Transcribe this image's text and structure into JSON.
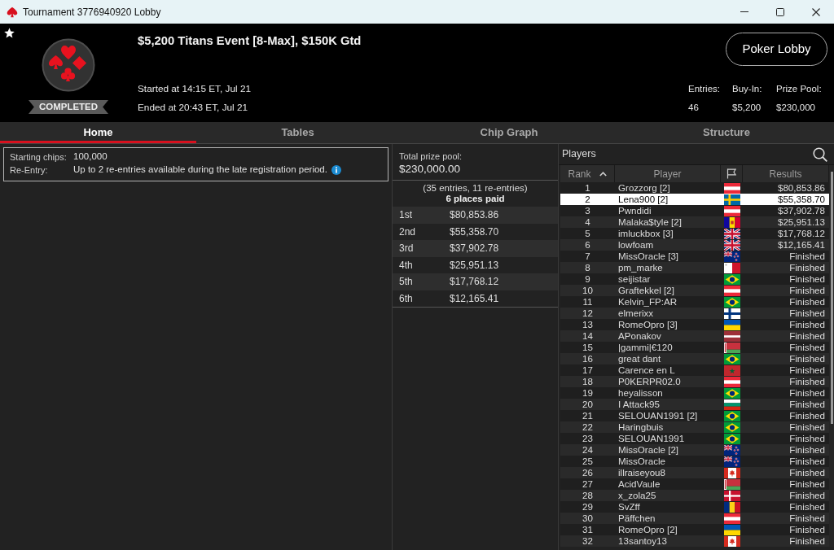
{
  "window": {
    "title": "Tournament 3776940920 Lobby"
  },
  "header": {
    "status": "COMPLETED",
    "title": "$5,200 Titans Event [8-Max], $150K Gtd",
    "started": "Started at 14:15 ET, Jul 21",
    "ended": "Ended at 20:43 ET, Jul 21",
    "button": "Poker Lobby",
    "stats": [
      {
        "label": "Entries:",
        "value": "46"
      },
      {
        "label": "Buy-In:",
        "value": "$5,200"
      },
      {
        "label": "Prize Pool:",
        "value": "$230,000"
      }
    ]
  },
  "tabs": [
    {
      "label": "Home",
      "selected": true
    },
    {
      "label": "Tables",
      "selected": false
    },
    {
      "label": "Chip Graph",
      "selected": false
    },
    {
      "label": "Structure",
      "selected": false
    }
  ],
  "info": [
    {
      "label": "Starting chips:",
      "value": "100,000",
      "info_icon": false
    },
    {
      "label": "Re-Entry:",
      "value": "Up to 2 re-entries available during the late registration period.",
      "info_icon": true
    }
  ],
  "prize_pool": {
    "label": "Total prize pool:",
    "total": "$230,000.00",
    "entries_note": "(35 entries, 11 re-entries)",
    "places_paid": "6 places paid",
    "payouts": [
      {
        "place": "1st",
        "amount": "$80,853.86"
      },
      {
        "place": "2nd",
        "amount": "$55,358.70"
      },
      {
        "place": "3rd",
        "amount": "$37,902.78"
      },
      {
        "place": "4th",
        "amount": "$25,951.13"
      },
      {
        "place": "5th",
        "amount": "$17,768.12"
      },
      {
        "place": "6th",
        "amount": "$12,165.41"
      }
    ]
  },
  "players": {
    "title": "Players",
    "columns": [
      {
        "kind": "text",
        "label": "Rank",
        "sorted": true
      },
      {
        "kind": "text",
        "label": "Player",
        "sorted": false
      },
      {
        "kind": "flag",
        "sorted": false
      },
      {
        "kind": "text",
        "label": "Results",
        "sorted": false
      }
    ],
    "rows": [
      {
        "rank": "1",
        "player": "Grozzorg [2]",
        "flag": {
          "kind": "at"
        },
        "result": "$80,853.86",
        "selected": false
      },
      {
        "rank": "2",
        "player": "Lena900 [2]",
        "flag": {
          "kind": "se"
        },
        "result": "$55,358.70",
        "selected": true
      },
      {
        "rank": "3",
        "player": "Pwndidi",
        "flag": {
          "kind": "at"
        },
        "result": "$37,902.78",
        "selected": false
      },
      {
        "rank": "4",
        "player": "Malaka$tyle [2]",
        "flag": {
          "kind": "ad"
        },
        "result": "$25,951.13",
        "selected": false
      },
      {
        "rank": "5",
        "player": "imluckbox [3]",
        "flag": {
          "kind": "gb"
        },
        "result": "$17,768.12",
        "selected": false
      },
      {
        "rank": "6",
        "player": "lowfoam",
        "flag": {
          "kind": "gb"
        },
        "result": "$12,165.41",
        "selected": false
      },
      {
        "rank": "7",
        "player": "MissOracle [3]",
        "flag": {
          "kind": "nz"
        },
        "result": "Finished",
        "selected": false
      },
      {
        "rank": "8",
        "player": "pm_marke",
        "flag": {
          "kind": "mt"
        },
        "result": "Finished",
        "selected": false
      },
      {
        "rank": "9",
        "player": "seijistar",
        "flag": {
          "kind": "br"
        },
        "result": "Finished",
        "selected": false
      },
      {
        "rank": "10",
        "player": "Graftekkel [2]",
        "flag": {
          "kind": "at"
        },
        "result": "Finished",
        "selected": false
      },
      {
        "rank": "11",
        "player": "Kelvin_FP:AR",
        "flag": {
          "kind": "br"
        },
        "result": "Finished",
        "selected": false
      },
      {
        "rank": "12",
        "player": "elmerixx",
        "flag": {
          "kind": "fi"
        },
        "result": "Finished",
        "selected": false
      },
      {
        "rank": "13",
        "player": "RomeOpro [3]",
        "flag": {
          "kind": "ua"
        },
        "result": "Finished",
        "selected": false
      },
      {
        "rank": "14",
        "player": "APonakov",
        "flag": {
          "kind": "lv"
        },
        "result": "Finished",
        "selected": false
      },
      {
        "rank": "15",
        "player": "|gammi|€120",
        "flag": {
          "kind": "by"
        },
        "result": "Finished",
        "selected": false
      },
      {
        "rank": "16",
        "player": "great dant",
        "flag": {
          "kind": "br"
        },
        "result": "Finished",
        "selected": false
      },
      {
        "rank": "17",
        "player": "Carence en L",
        "flag": {
          "kind": "ma"
        },
        "result": "Finished",
        "selected": false
      },
      {
        "rank": "18",
        "player": "P0KERPR02.0",
        "flag": {
          "kind": "at"
        },
        "result": "Finished",
        "selected": false
      },
      {
        "rank": "19",
        "player": "heyalisson",
        "flag": {
          "kind": "br"
        },
        "result": "Finished",
        "selected": false
      },
      {
        "rank": "20",
        "player": "I Attack95",
        "flag": {
          "kind": "bg"
        },
        "result": "Finished",
        "selected": false
      },
      {
        "rank": "21",
        "player": "SELOUAN1991 [2]",
        "flag": {
          "kind": "br"
        },
        "result": "Finished",
        "selected": false
      },
      {
        "rank": "22",
        "player": "Haringbuis",
        "flag": {
          "kind": "br"
        },
        "result": "Finished",
        "selected": false
      },
      {
        "rank": "23",
        "player": "SELOUAN1991",
        "flag": {
          "kind": "br"
        },
        "result": "Finished",
        "selected": false
      },
      {
        "rank": "24",
        "player": "MissOracle [2]",
        "flag": {
          "kind": "nz"
        },
        "result": "Finished",
        "selected": false
      },
      {
        "rank": "25",
        "player": "MissOracle",
        "flag": {
          "kind": "nz"
        },
        "result": "Finished",
        "selected": false
      },
      {
        "rank": "26",
        "player": "illraiseyou8",
        "flag": {
          "kind": "ca"
        },
        "result": "Finished",
        "selected": false
      },
      {
        "rank": "27",
        "player": "AcidVaule",
        "flag": {
          "kind": "by"
        },
        "result": "Finished",
        "selected": false
      },
      {
        "rank": "28",
        "player": "x_zola25",
        "flag": {
          "kind": "dk"
        },
        "result": "Finished",
        "selected": false
      },
      {
        "rank": "29",
        "player": "SvZff",
        "flag": {
          "kind": "ro"
        },
        "result": "Finished",
        "selected": false
      },
      {
        "rank": "30",
        "player": "Päffchen",
        "flag": {
          "kind": "at"
        },
        "result": "Finished",
        "selected": false
      },
      {
        "rank": "31",
        "player": "RomeOpro [2]",
        "flag": {
          "kind": "ua"
        },
        "result": "Finished",
        "selected": false
      },
      {
        "rank": "32",
        "player": "13santoy13",
        "flag": {
          "kind": "ca"
        },
        "result": "Finished",
        "selected": false
      }
    ]
  }
}
